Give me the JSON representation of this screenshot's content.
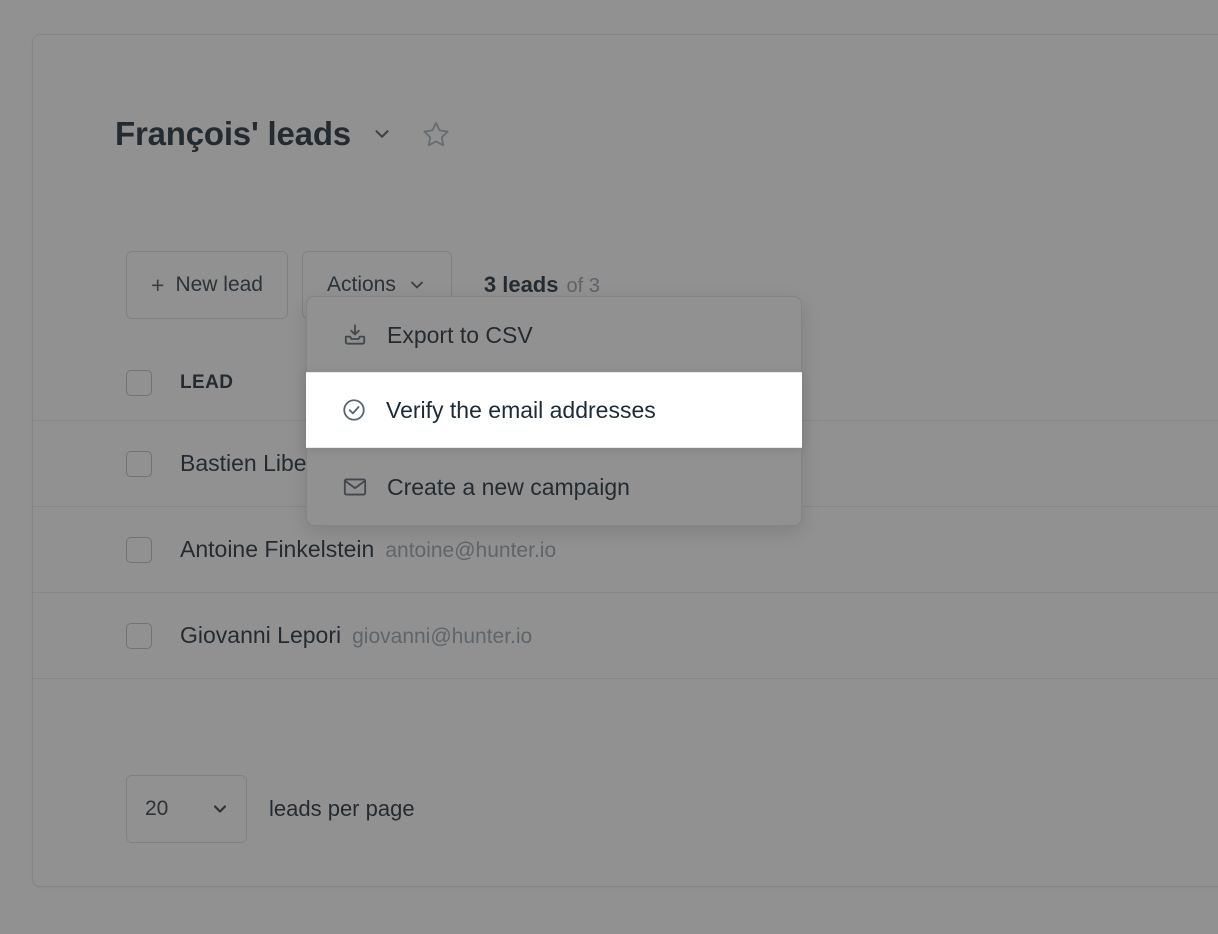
{
  "header": {
    "title": "François' leads",
    "title_chevron_icon": "chevron-down-icon",
    "favorite_icon": "star-icon"
  },
  "toolbar": {
    "new_lead_label": "New lead",
    "new_lead_plus": "+",
    "actions_label": "Actions",
    "actions_chevron_icon": "chevron-down-icon",
    "count_strong": "3 leads",
    "count_muted": "of 3"
  },
  "menu": {
    "items": [
      {
        "label": "Export to CSV",
        "icon": "download-tray-icon",
        "highlighted": false
      },
      {
        "label": "Verify the email addresses",
        "icon": "check-circle-icon",
        "highlighted": true
      },
      {
        "label": "Create a new campaign",
        "icon": "envelope-icon",
        "highlighted": false
      }
    ]
  },
  "table": {
    "columns": [
      "LEAD"
    ],
    "rows": [
      {
        "name": "Bastien Libe",
        "email": ""
      },
      {
        "name": "Antoine Finkelstein",
        "email": "antoine@hunter.io"
      },
      {
        "name": "Giovanni Lepori",
        "email": "giovanni@hunter.io"
      }
    ]
  },
  "footer": {
    "per_page_value": "20",
    "per_page_options": [
      "20"
    ],
    "per_page_label": "leads per page",
    "select_chevron_icon": "chevron-down-icon"
  },
  "colors": {
    "text": "#1d2b36",
    "muted": "#9aa4ac",
    "border": "#e3e6ea",
    "overlay": "rgba(45,45,45,.52)",
    "menu_bg": "#ffffff"
  }
}
